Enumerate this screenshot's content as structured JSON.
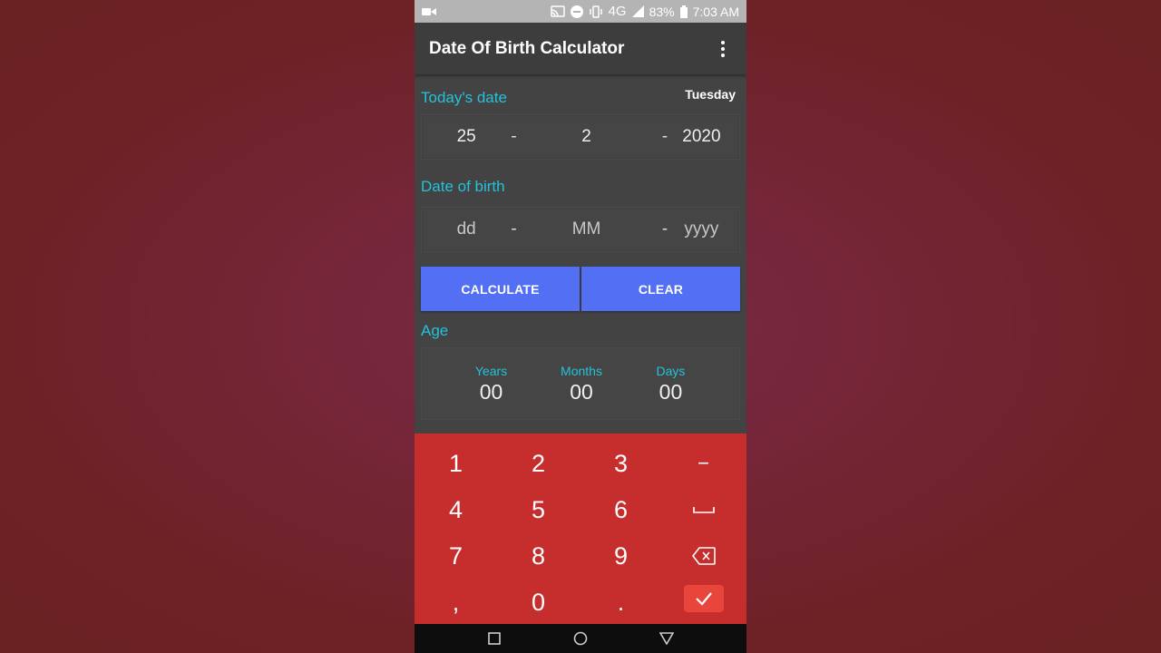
{
  "statusbar": {
    "network": "4G",
    "battery": "83%",
    "time": "7:03 AM",
    "icons": [
      "camera-icon",
      "cast-icon",
      "dnd-icon",
      "vibrate-icon",
      "signal-icon",
      "battery-icon"
    ]
  },
  "appbar": {
    "title": "Date Of Birth Calculator",
    "menu_icon": "more-vert-icon"
  },
  "today": {
    "label": "Today's date",
    "weekday": "Tuesday",
    "day": "25",
    "month": "2",
    "year": "2020",
    "separator": "-"
  },
  "dob": {
    "label": "Date of birth",
    "day_placeholder": "dd",
    "month_placeholder": "MM",
    "year_placeholder": "yyyy",
    "separator": "-"
  },
  "buttons": {
    "calculate": "CALCULATE",
    "clear": "CLEAR"
  },
  "age": {
    "label": "Age",
    "years_label": "Years",
    "months_label": "Months",
    "days_label": "Days",
    "years": "00",
    "months": "00",
    "days": "00"
  },
  "keyboard": {
    "k1": "1",
    "k2": "2",
    "k3": "3",
    "minus": "−",
    "k4": "4",
    "k5": "5",
    "k6": "6",
    "k7": "7",
    "k8": "8",
    "k9": "9",
    "comma": ",",
    "k0": "0",
    "dot": ".",
    "space_icon": "space-icon",
    "backspace_icon": "backspace-icon",
    "done_icon": "check-icon"
  },
  "navbar": {
    "icons": [
      "recents-icon",
      "home-icon",
      "back-icon"
    ]
  },
  "colors": {
    "accent": "#22c3da",
    "button": "#5370f5",
    "keyboard": "#c62d2d",
    "done_key": "#e8463c"
  }
}
